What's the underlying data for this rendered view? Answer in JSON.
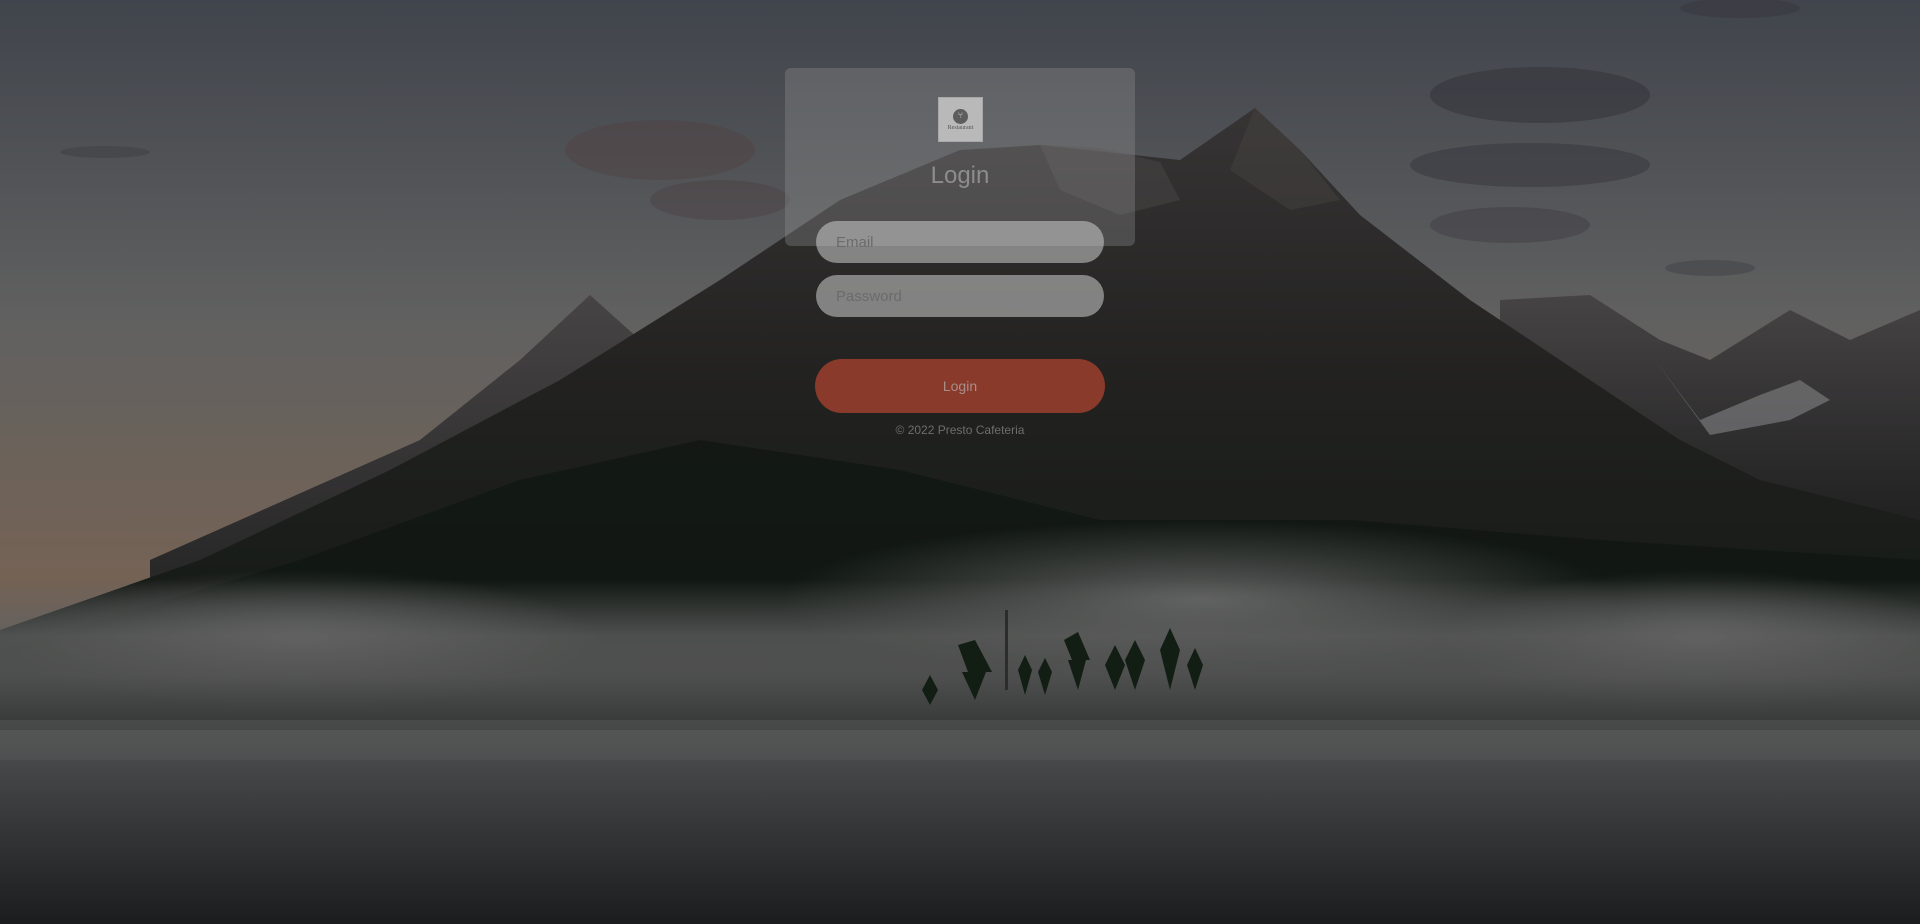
{
  "logo": {
    "icon": "fork-knife-icon",
    "text": "Restaurant"
  },
  "login_form": {
    "title": "Login",
    "email_placeholder": "Email",
    "password_placeholder": "Password",
    "submit_label": "Login"
  },
  "footer": {
    "copyright": "© 2022 Presto Cafeteria"
  },
  "colors": {
    "button": "#8a3a2b",
    "overlay": "rgba(0,0,0,0.42)"
  }
}
